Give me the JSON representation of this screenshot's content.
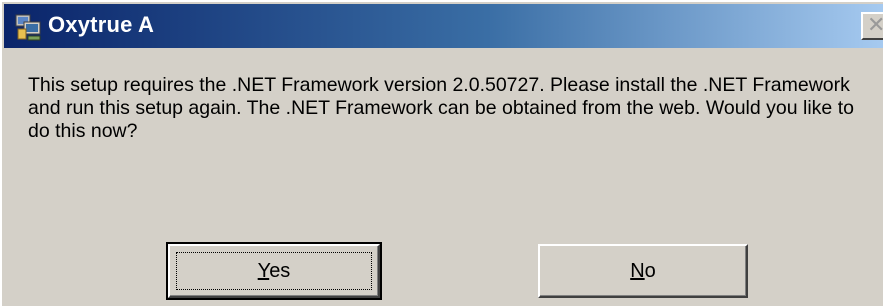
{
  "window": {
    "title": "Oxytrue A",
    "icon": "setup-installer-icon",
    "close_glyph": "✕"
  },
  "message": {
    "text": "This setup requires the .NET Framework version 2.0.50727.  Please install the .NET Framework and run this setup again.  The .NET Framework can be obtained from the web.  Would you like to do this now?"
  },
  "buttons": {
    "yes": {
      "accel": "Y",
      "rest": "es"
    },
    "no": {
      "accel": "N",
      "rest": "o"
    }
  },
  "colors": {
    "dialog_face": "#d4d0c8",
    "title_start": "#0a246a",
    "title_end": "#a6caf0",
    "title_text": "#ffffff"
  }
}
